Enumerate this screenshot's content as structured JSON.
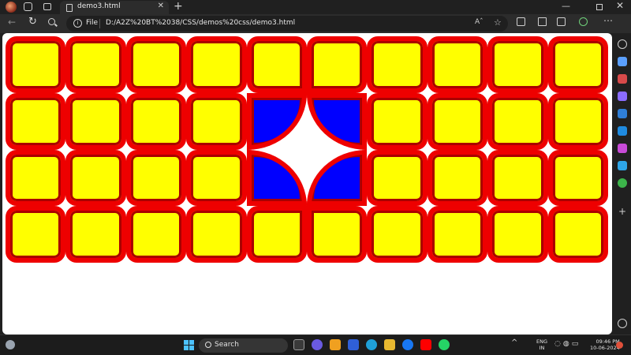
{
  "tab": {
    "title": "demo3.html",
    "close": "✕"
  },
  "newtab": "+",
  "window": {
    "minimize": "—",
    "close": "✕"
  },
  "nav": {
    "back": "←",
    "refresh": "↻"
  },
  "address": {
    "info": "i",
    "scheme": "File",
    "url": "D:/A2Z%20BT%2038/CSS/demos%20css/demo3.html"
  },
  "toolbar": {
    "readaloud": "Aˆ",
    "favorite": "☆",
    "menu": "⋯"
  },
  "taskbar": {
    "search_label": "Search",
    "language": [
      "ENG",
      "IN"
    ],
    "time": "09:46 PM",
    "date": "10-06-2024",
    "tray_caret": "^"
  },
  "colors": {
    "tile_fill": "#ffff00",
    "tile_border": "#ee0000",
    "quarter_fill": "#0000ff",
    "background": "#ffffff"
  },
  "grid": {
    "rows": [
      [
        "sq",
        "sq",
        "sq",
        "sq",
        "sq-br",
        "sq-bl",
        "sq",
        "sq",
        "sq",
        "sq"
      ],
      [
        "sq",
        "sq",
        "sq",
        "sq",
        "q-tl",
        "q-tr",
        "sq",
        "sq",
        "sq",
        "sq"
      ],
      [
        "sq",
        "sq",
        "sq",
        "sq",
        "q-bl",
        "q-br",
        "sq",
        "sq",
        "sq",
        "sq"
      ],
      [
        "sq",
        "sq",
        "sq",
        "sq",
        "sq-tr",
        "sq-tl",
        "sq",
        "sq",
        "sq",
        "sq"
      ]
    ]
  }
}
